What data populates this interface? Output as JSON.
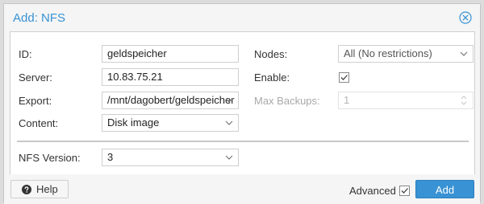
{
  "dialog": {
    "title": "Add: NFS",
    "close_icon": "close-circle-icon"
  },
  "form": {
    "id": {
      "label": "ID:",
      "value": "geldspeicher"
    },
    "server": {
      "label": "Server:",
      "value": "10.83.75.21"
    },
    "export": {
      "label": "Export:",
      "value": "/mnt/dagobert/geldspeicher"
    },
    "content": {
      "label": "Content:",
      "value": "Disk image"
    },
    "nodes": {
      "label": "Nodes:",
      "value": "All (No restrictions)"
    },
    "enable": {
      "label": "Enable:",
      "checked": true
    },
    "max_backups": {
      "label": "Max Backups:",
      "value": "1",
      "disabled": true
    },
    "nfs_version": {
      "label": "NFS Version:",
      "value": "3"
    }
  },
  "footer": {
    "help_label": "Help",
    "help_icon": "question-circle-icon",
    "advanced_label": "Advanced",
    "advanced_checked": true,
    "add_label": "Add"
  },
  "colors": {
    "accent": "#3892d4",
    "title": "#3892d4"
  }
}
